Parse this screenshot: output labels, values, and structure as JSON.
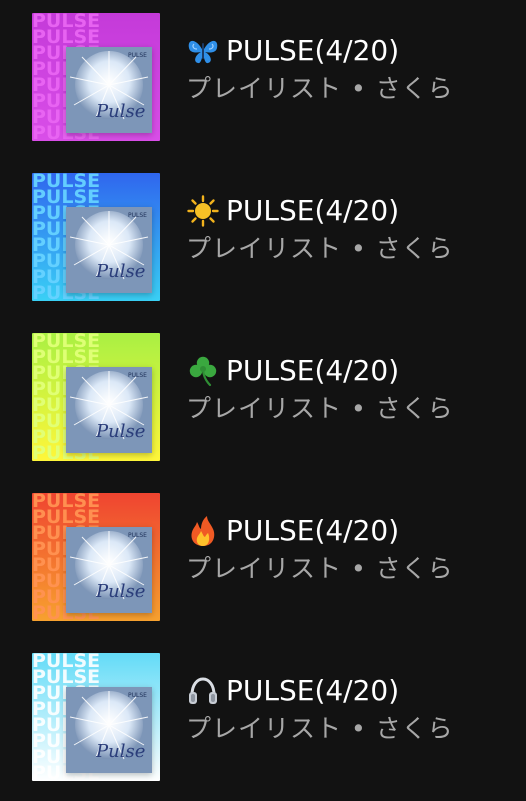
{
  "playlists": [
    {
      "emoji": "butterfly-icon",
      "title": "PULSE(4/20)",
      "subtitle": "プレイリスト • さくら",
      "cover_gradient": [
        "#c43ad9",
        "#d94ee8"
      ],
      "cover_word": "PULSE",
      "cover_word_color": "#e65cf0"
    },
    {
      "emoji": "sun-icon",
      "title": " PULSE(4/20)",
      "subtitle": "プレイリスト • さくら",
      "cover_gradient": [
        "#2f66ee",
        "#3ad0f5"
      ],
      "cover_word": "PULSE",
      "cover_word_color": "#56c8ff"
    },
    {
      "emoji": "shamrock-icon",
      "title": "PULSE(4/20)",
      "subtitle": "プレイリスト • さくら",
      "cover_gradient": [
        "#a9f043",
        "#fff63a"
      ],
      "cover_word": "PULSE",
      "cover_word_color": "#d6ff66"
    },
    {
      "emoji": "fire-icon",
      "title": "PULSE(4/20)",
      "subtitle": "プレイリスト • さくら",
      "cover_gradient": [
        "#ef4430",
        "#f7a12f"
      ],
      "cover_word": "PULSE",
      "cover_word_color": "#ff8b4a"
    },
    {
      "emoji": "headphones-icon",
      "title": "PULSE(4/20)",
      "subtitle": "プレイリスト • さくら",
      "cover_gradient": [
        "#63dbf7",
        "#ffffff"
      ],
      "cover_word": "PULSE",
      "cover_word_color": "#ffffff"
    }
  ],
  "album_art": {
    "label": "PULSE",
    "script_title": "Pulse"
  }
}
